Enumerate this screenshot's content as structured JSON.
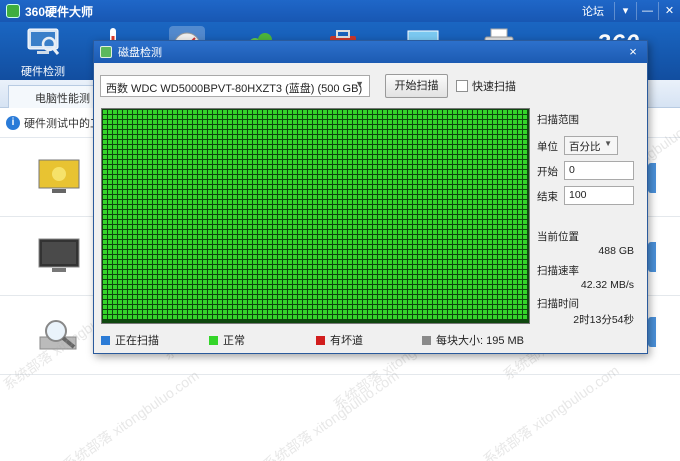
{
  "app": {
    "title": "360硬件大师",
    "forum_link": "论坛",
    "menu_btn": "▾",
    "min_btn": "—",
    "brand": "360",
    "toolbar_active_label": "硬件检测",
    "tab_label": "电脑性能测试",
    "notice": "硬件测试中的工"
  },
  "dialog": {
    "title": "磁盘检测",
    "close": "×",
    "disk_select": "西数 WDC WD5000BPVT-80HXZT3 (蓝盘)  (500 GB)",
    "disk_arrow": "▼",
    "start_button": "开始扫描",
    "quick_scan": "快速扫描",
    "quick_scan_checked": false,
    "side": {
      "range_title": "扫描范围",
      "unit_label": "单位",
      "unit_value": "百分比",
      "unit_arrow": "▼",
      "start_label": "开始",
      "start_value": "0",
      "end_label": "结束",
      "end_value": "100",
      "pos_title": "当前位置",
      "pos_value": "488 GB",
      "speed_title": "扫描速率",
      "speed_value": "42.32 MB/s",
      "time_title": "扫描时间",
      "time_value": "2时13分54秒"
    },
    "legend": {
      "scanning": "正在扫描",
      "normal": "正常",
      "bad": "有坏道",
      "block_size": "每块大小:  195 MB"
    },
    "grid_state": "all-normal",
    "colors": {
      "scanning": "#2b7bd6",
      "normal": "#34d52a",
      "bad": "#d11d1d",
      "block": "#8a8a8a",
      "grid_line": "#0f470f"
    }
  },
  "watermark": "系统部落 xitongbuluo.com"
}
